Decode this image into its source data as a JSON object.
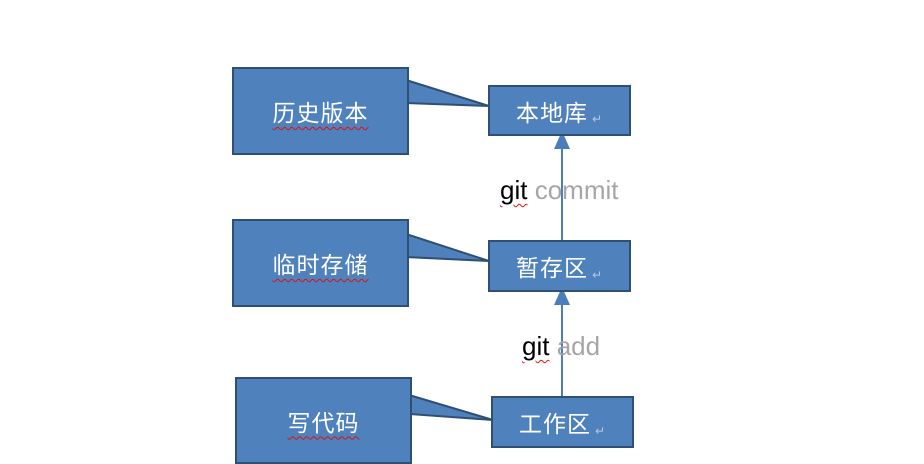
{
  "labels": {
    "history": "历史版本",
    "temp_storage": "临时存储",
    "write_code": "写代码"
  },
  "stages": {
    "local_repo": "本地库",
    "staging_area": "暂存区",
    "working_dir": "工作区"
  },
  "commands": {
    "commit": {
      "git": "git",
      "arg": "commit"
    },
    "add": {
      "git": "git",
      "arg": "add"
    }
  },
  "colors": {
    "box_fill": "#4f81bd",
    "box_border": "#2f4f73",
    "arrow": "#4a7ebb",
    "command_arg": "#a6a6a6"
  }
}
